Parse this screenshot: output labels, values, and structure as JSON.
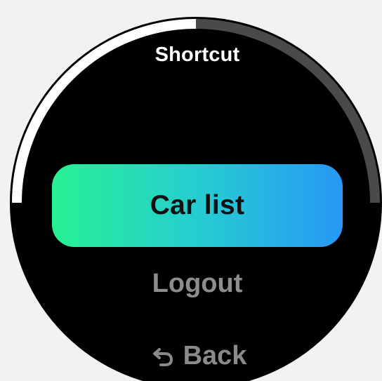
{
  "screen": {
    "title": "Shortcut",
    "scroll_progress": 0.5
  },
  "actions": {
    "primary_label": "Car list",
    "logout_label": "Logout",
    "back_label": "Back"
  },
  "colors": {
    "background": "#f1f2f4",
    "watch_face": "#000000",
    "primary_gradient_start": "#27f193",
    "primary_gradient_end": "#2798f6",
    "arc_active": "#ffffff",
    "arc_inactive": "#4a4a4a"
  },
  "icons": {
    "back": "back-arrow-icon"
  }
}
